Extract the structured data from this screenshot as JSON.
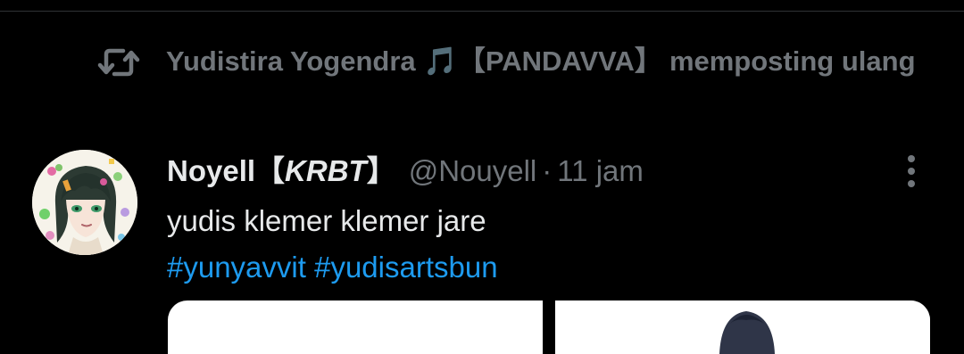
{
  "repost": {
    "icon": "repost-icon",
    "user": "Yudistira Yogendra 🎵【PANDAVVA】",
    "action": "memposting ulang"
  },
  "tweet": {
    "avatar_icon": "avatar",
    "display_name": "Noyell【",
    "display_name_tag": "KRBT",
    "display_name_end": "】",
    "handle": "@Nouyell",
    "separator": "·",
    "time": "11 jam",
    "more_icon": "more-vertical-icon",
    "text": "yudis klemer klemer jare",
    "hashtags": [
      "#yunyavvit",
      "#yudisartsbun"
    ]
  },
  "colors": {
    "background": "#000000",
    "primary_text": "#e7e9ea",
    "secondary_text": "#71767b",
    "link": "#1d9bf0"
  }
}
